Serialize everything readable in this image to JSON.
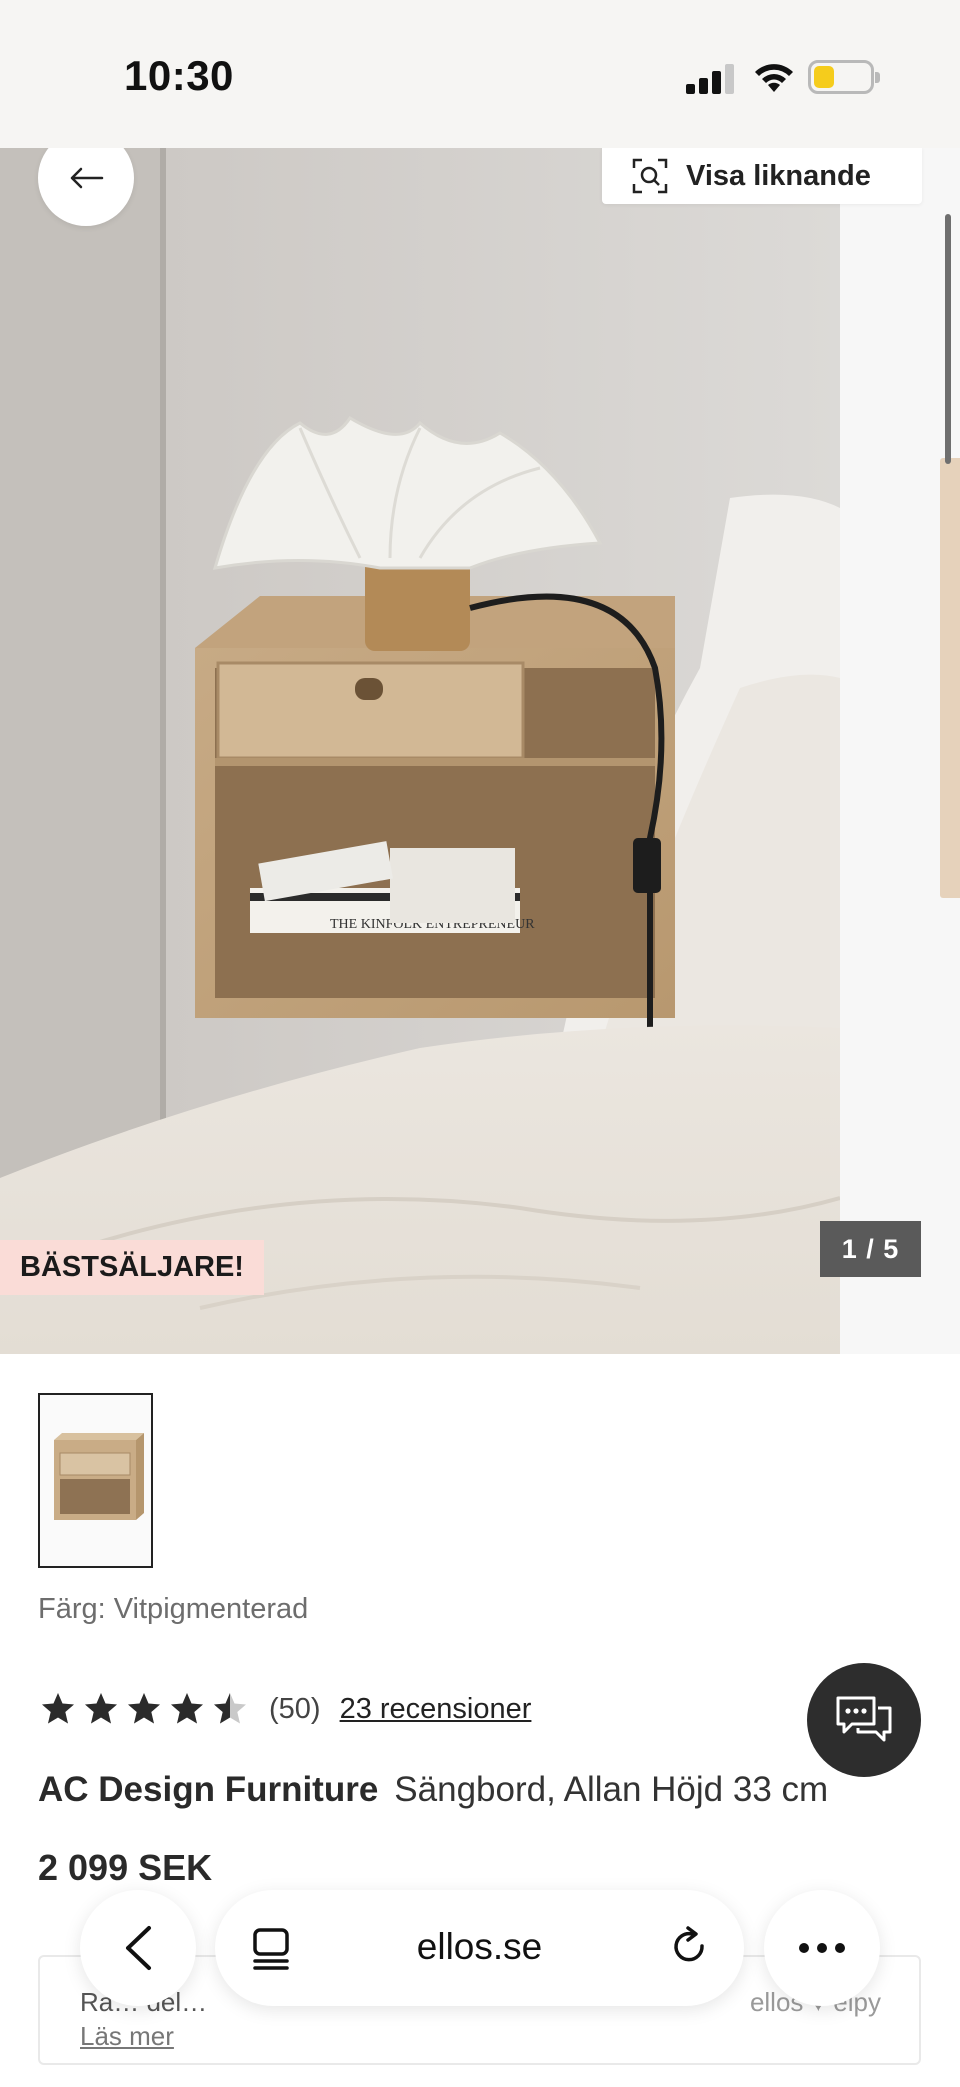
{
  "status_bar": {
    "time": "10:30",
    "battery_color": "#f5cc1c"
  },
  "gallery": {
    "visa_liknande_label": "Visa liknande",
    "badge_label": "BÄSTSÄLJARE!",
    "badge_color": "#fadcd7",
    "counter_label": "1 / 5"
  },
  "product": {
    "color_label": "Färg: Vitpigmenterad",
    "rating": 4.5,
    "rating_max": 5,
    "review_count_label": "(50)",
    "reviews_link": "23 recensioner",
    "brand": "AC Design Furniture",
    "name": "Sängbord, Allan Höjd 33 cm",
    "price": "2 099 SEK"
  },
  "payment_box": {
    "text": "Ra… del…",
    "link": "Läs mer",
    "brand_text": "ellos ♥ elpy"
  },
  "browser": {
    "url": "ellos.se"
  },
  "icons": {
    "back": "arrow-left-icon",
    "visual_search": "visual-search-icon",
    "chat": "chat-bubbles-icon",
    "tabs": "tabs-icon",
    "reload": "reload-icon",
    "more": "more-dots-icon"
  }
}
